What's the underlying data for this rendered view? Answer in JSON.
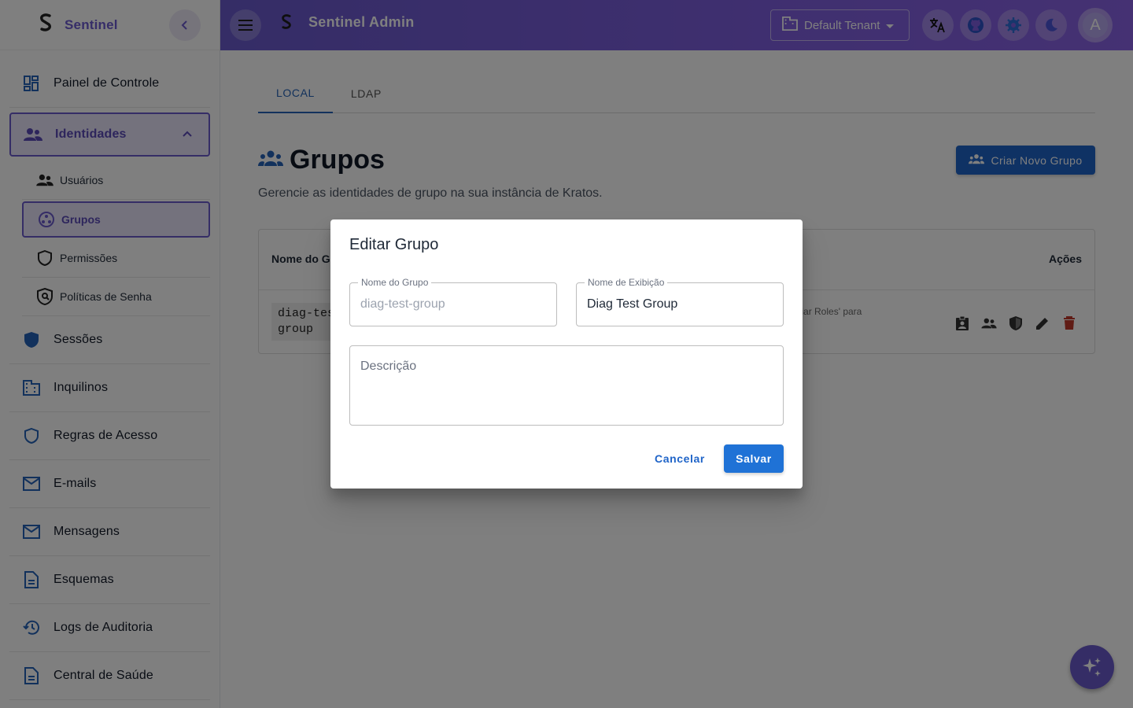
{
  "app": {
    "brand": "Sentinel",
    "title": "Sentinel Admin",
    "accent_color": "#6a5acd",
    "primary_color": "#1f64c8"
  },
  "topbar": {
    "tenant_label": "Default Tenant",
    "avatar_initial": "A",
    "icons": [
      "menu-icon",
      "translate-icon",
      "github-icon",
      "settings-icon",
      "dark-mode-icon"
    ]
  },
  "sidebar": {
    "items": [
      {
        "label": "Painel de Controle",
        "icon": "dashboard-icon"
      },
      {
        "label": "Identidades",
        "icon": "people-icon"
      },
      {
        "label": "Sessões",
        "icon": "shield-icon"
      },
      {
        "label": "Inquilinos",
        "icon": "building-icon"
      },
      {
        "label": "Regras de Acesso",
        "icon": "shield-outline-icon"
      },
      {
        "label": "E-mails",
        "icon": "mail-icon"
      },
      {
        "label": "Mensagens",
        "icon": "mail-icon"
      },
      {
        "label": "Esquemas",
        "icon": "document-icon"
      },
      {
        "label": "Logs de Auditoria",
        "icon": "history-icon"
      },
      {
        "label": "Central de Saúde",
        "icon": "document-icon"
      }
    ],
    "sub_items": [
      {
        "label": "Usuários",
        "icon": "people-icon"
      },
      {
        "label": "Grupos",
        "icon": "workspaces-icon"
      },
      {
        "label": "Permissões",
        "icon": "shield-outline-icon"
      },
      {
        "label": "Políticas de Senha",
        "icon": "policy-icon"
      }
    ]
  },
  "main": {
    "tabs": [
      {
        "label": "LOCAL",
        "active": true
      },
      {
        "label": "LDAP",
        "active": false
      }
    ],
    "page_title": "Grupos",
    "page_subtitle": "Gerencie as identidades de grupo na sua instância de Kratos.",
    "create_button": "Criar Novo Grupo",
    "table": {
      "headers": {
        "name": "Nome do G",
        "actions": "Ações"
      },
      "rows": [
        {
          "name_line1": "diag-tes",
          "name_line2": "group",
          "desc_fragment": "enciar Roles' para"
        }
      ]
    }
  },
  "dialog": {
    "title": "Editar Grupo",
    "group_name_label": "Nome do Grupo",
    "group_name_placeholder": "diag-test-group",
    "display_name_label": "Nome de Exibição",
    "display_name_value": "Diag Test Group",
    "description_placeholder": "Descrição",
    "cancel_label": "Cancelar",
    "save_label": "Salvar"
  }
}
